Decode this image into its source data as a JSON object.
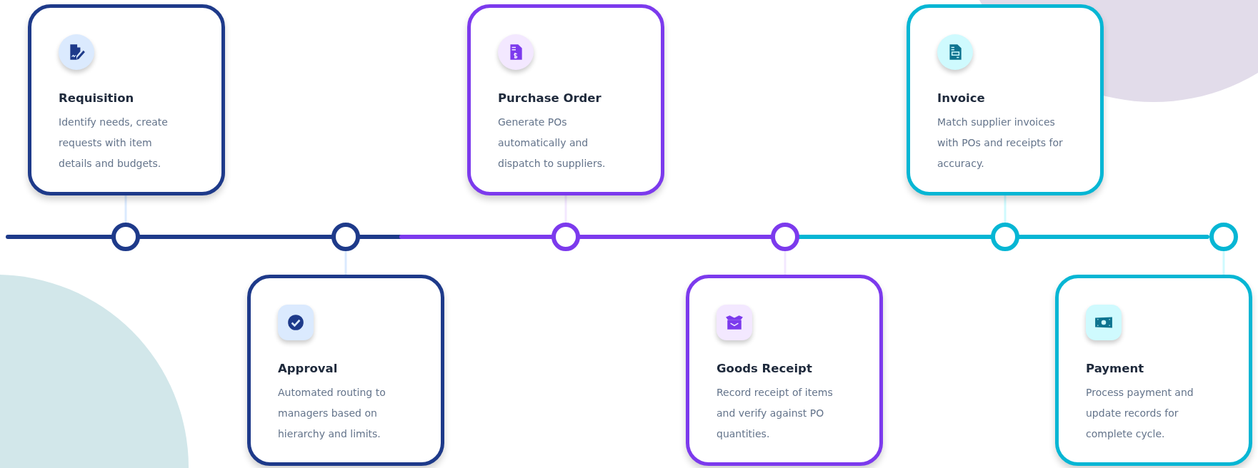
{
  "steps": [
    {
      "title": "Requisition",
      "description": "Identify needs, create requests with item details and budgets.",
      "color": "#1e3a8a"
    },
    {
      "title": "Approval",
      "description": "Automated routing to managers based on hierarchy and limits.",
      "color": "#1e3a8a"
    },
    {
      "title": "Purchase Order",
      "description": "Generate POs automatically and dispatch to suppliers.",
      "color": "#7c3aed"
    },
    {
      "title": "Goods Receipt",
      "description": "Record receipt of items and verify against PO quantities.",
      "color": "#7c3aed"
    },
    {
      "title": "Invoice",
      "description": "Match supplier invoices with POs and receipts for accuracy.",
      "color": "#06b6d4"
    },
    {
      "title": "Payment",
      "description": "Process payment and update records for complete cycle.",
      "color": "#06b6d4"
    }
  ]
}
